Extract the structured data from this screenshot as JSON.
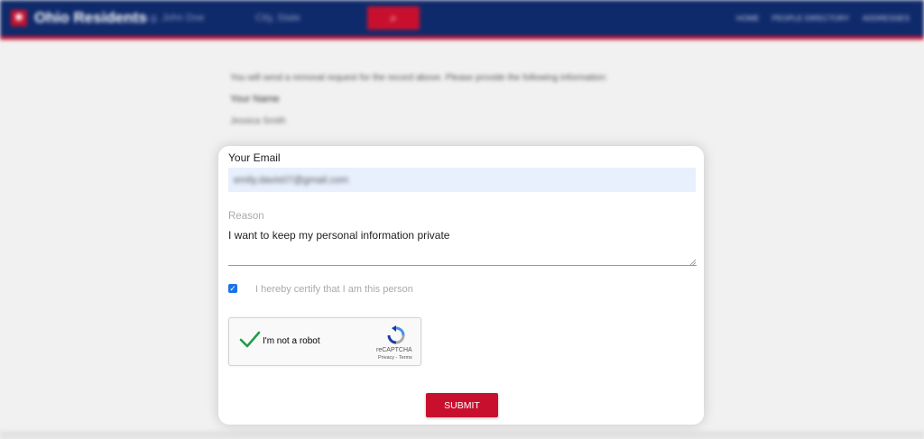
{
  "header": {
    "brand": "Ohio Residents",
    "name_placeholder": "e.g. John Doe",
    "city_placeholder": "City, State",
    "nav": [
      "HOME",
      "PEOPLE DIRECTORY",
      "ADDRESSES"
    ]
  },
  "background": {
    "intro": "You will send a removal request for the record above. Please provide the following information:",
    "your_name_label": "Your Name",
    "your_name_value": "Jessica Smith"
  },
  "form": {
    "email_label": "Your Email",
    "email_value": "emily.davis07@gmail.com",
    "reason_label": "Reason",
    "reason_value": "I want to keep my personal information private",
    "certify_label": "I hereby certify that I am this person",
    "certify_checked": true,
    "submit_label": "SUBMIT"
  },
  "recaptcha": {
    "label": "I'm not a robot",
    "brand": "reCAPTCHA",
    "links": "Privacy - Terms",
    "verified": true
  },
  "colors": {
    "header_bg": "#0f2a6b",
    "accent_red": "#c8102e",
    "checkbox_blue": "#1a73e8",
    "email_field_bg": "#e8f0fe"
  }
}
